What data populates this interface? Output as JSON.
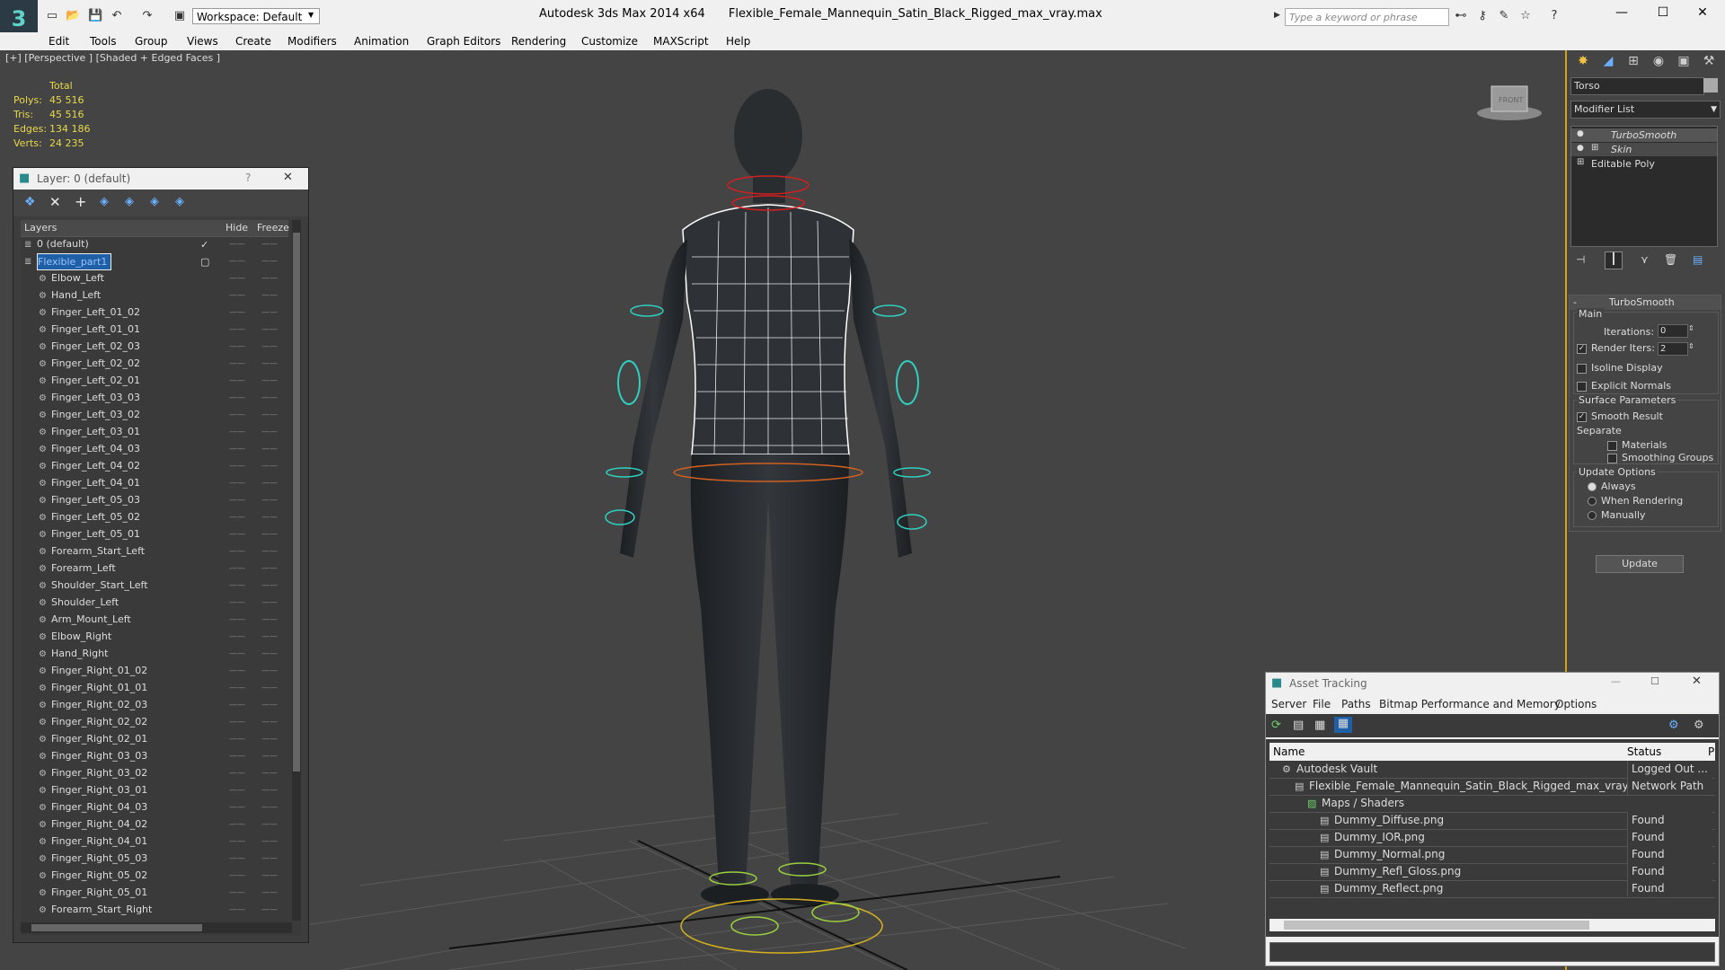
{
  "titlebar": {
    "app_title": "Autodesk 3ds Max  2014 x64",
    "file_name": "Flexible_Female_Mannequin_Satin_Black_Rigged_max_vray.max",
    "workspace": "Workspace: Default",
    "search_placeholder": "Type a keyword or phrase"
  },
  "menu": [
    "Edit",
    "Tools",
    "Group",
    "Views",
    "Create",
    "Modifiers",
    "Animation",
    "Graph Editors",
    "Rendering",
    "Customize",
    "MAXScript",
    "Help"
  ],
  "viewport": {
    "label": "[+] [Perspective ] [Shaded + Edged Faces ]",
    "stats": {
      "header": "Total",
      "rows": [
        {
          "label": "Polys:",
          "value": "45 516"
        },
        {
          "label": "Tris:",
          "value": "45 516"
        },
        {
          "label": "Edges:",
          "value": "134 186"
        },
        {
          "label": "Verts:",
          "value": "24 235"
        }
      ]
    }
  },
  "layer_dialog": {
    "title": "Layer: 0 (default)",
    "col_layers": "Layers",
    "col_hide": "Hide",
    "col_freeze": "Freeze",
    "dash": "——",
    "rows": [
      {
        "name": "0 (default)",
        "level": 0,
        "selected": false,
        "checked": true
      },
      {
        "name": "Flexible_part1",
        "level": 0,
        "selected": true,
        "checked": false
      },
      {
        "name": "Elbow_Left",
        "level": 1
      },
      {
        "name": "Hand_Left",
        "level": 1
      },
      {
        "name": "Finger_Left_01_02",
        "level": 1
      },
      {
        "name": "Finger_Left_01_01",
        "level": 1
      },
      {
        "name": "Finger_Left_02_03",
        "level": 1
      },
      {
        "name": "Finger_Left_02_02",
        "level": 1
      },
      {
        "name": "Finger_Left_02_01",
        "level": 1
      },
      {
        "name": "Finger_Left_03_03",
        "level": 1
      },
      {
        "name": "Finger_Left_03_02",
        "level": 1
      },
      {
        "name": "Finger_Left_03_01",
        "level": 1
      },
      {
        "name": "Finger_Left_04_03",
        "level": 1
      },
      {
        "name": "Finger_Left_04_02",
        "level": 1
      },
      {
        "name": "Finger_Left_04_01",
        "level": 1
      },
      {
        "name": "Finger_Left_05_03",
        "level": 1
      },
      {
        "name": "Finger_Left_05_02",
        "level": 1
      },
      {
        "name": "Finger_Left_05_01",
        "level": 1
      },
      {
        "name": "Forearm_Start_Left",
        "level": 1
      },
      {
        "name": "Forearm_Left",
        "level": 1
      },
      {
        "name": "Shoulder_Start_Left",
        "level": 1
      },
      {
        "name": "Shoulder_Left",
        "level": 1
      },
      {
        "name": "Arm_Mount_Left",
        "level": 1
      },
      {
        "name": "Elbow_Right",
        "level": 1
      },
      {
        "name": "Hand_Right",
        "level": 1
      },
      {
        "name": "Finger_Right_01_02",
        "level": 1
      },
      {
        "name": "Finger_Right_01_01",
        "level": 1
      },
      {
        "name": "Finger_Right_02_03",
        "level": 1
      },
      {
        "name": "Finger_Right_02_02",
        "level": 1
      },
      {
        "name": "Finger_Right_02_01",
        "level": 1
      },
      {
        "name": "Finger_Right_03_03",
        "level": 1
      },
      {
        "name": "Finger_Right_03_02",
        "level": 1
      },
      {
        "name": "Finger_Right_03_01",
        "level": 1
      },
      {
        "name": "Finger_Right_04_03",
        "level": 1
      },
      {
        "name": "Finger_Right_04_02",
        "level": 1
      },
      {
        "name": "Finger_Right_04_01",
        "level": 1
      },
      {
        "name": "Finger_Right_05_03",
        "level": 1
      },
      {
        "name": "Finger_Right_05_02",
        "level": 1
      },
      {
        "name": "Finger_Right_05_01",
        "level": 1
      },
      {
        "name": "Forearm_Start_Right",
        "level": 1
      }
    ]
  },
  "command_panel": {
    "object_name": "Torso",
    "modifier_list": "Modifier List",
    "stack": [
      {
        "name": "TurboSmooth",
        "italic": true
      },
      {
        "name": "Skin",
        "italic": true
      },
      {
        "name": "Editable Poly",
        "italic": false
      }
    ],
    "turbosmooth": {
      "title": "TurboSmooth",
      "main": "Main",
      "iterations_label": "Iterations:",
      "iterations_value": "0",
      "render_iters_label": "Render Iters:",
      "render_iters_value": "2",
      "isoline": "Isoline Display",
      "explicit_normals": "Explicit Normals",
      "surface_params": "Surface Parameters",
      "smooth_result": "Smooth Result",
      "separate": "Separate",
      "materials": "Materials",
      "smoothing_groups": "Smoothing Groups",
      "update_options": "Update Options",
      "always": "Always",
      "when_rendering": "When Rendering",
      "manually": "Manually",
      "update_button": "Update"
    }
  },
  "asset_tracking": {
    "title": "Asset Tracking",
    "menu": [
      "Server",
      "File",
      "Paths",
      "Bitmap Performance and Memory",
      "Options"
    ],
    "col_name": "Name",
    "col_status": "Status",
    "col_p": "P",
    "rows": [
      {
        "name": "Autodesk Vault",
        "status": "Logged Out ...",
        "indent": 1
      },
      {
        "name": "Flexible_Female_Mannequin_Satin_Black_Rigged_max_vray.max",
        "status": "Network Path",
        "indent": 2
      },
      {
        "name": "Maps / Shaders",
        "status": "",
        "indent": 3
      },
      {
        "name": "Dummy_Diffuse.png",
        "status": "Found",
        "indent": 4
      },
      {
        "name": "Dummy_IOR.png",
        "status": "Found",
        "indent": 4
      },
      {
        "name": "Dummy_Normal.png",
        "status": "Found",
        "indent": 4
      },
      {
        "name": "Dummy_Refl_Gloss.png",
        "status": "Found",
        "indent": 4
      },
      {
        "name": "Dummy_Reflect.png",
        "status": "Found",
        "indent": 4
      }
    ]
  },
  "colors": {
    "viewport_bg": "#444444",
    "selection": "#1e5fa6",
    "stat_yellow": "#e8d84a",
    "rig_cyan": "#2fd0c0",
    "panel_border": "#d4a017"
  }
}
